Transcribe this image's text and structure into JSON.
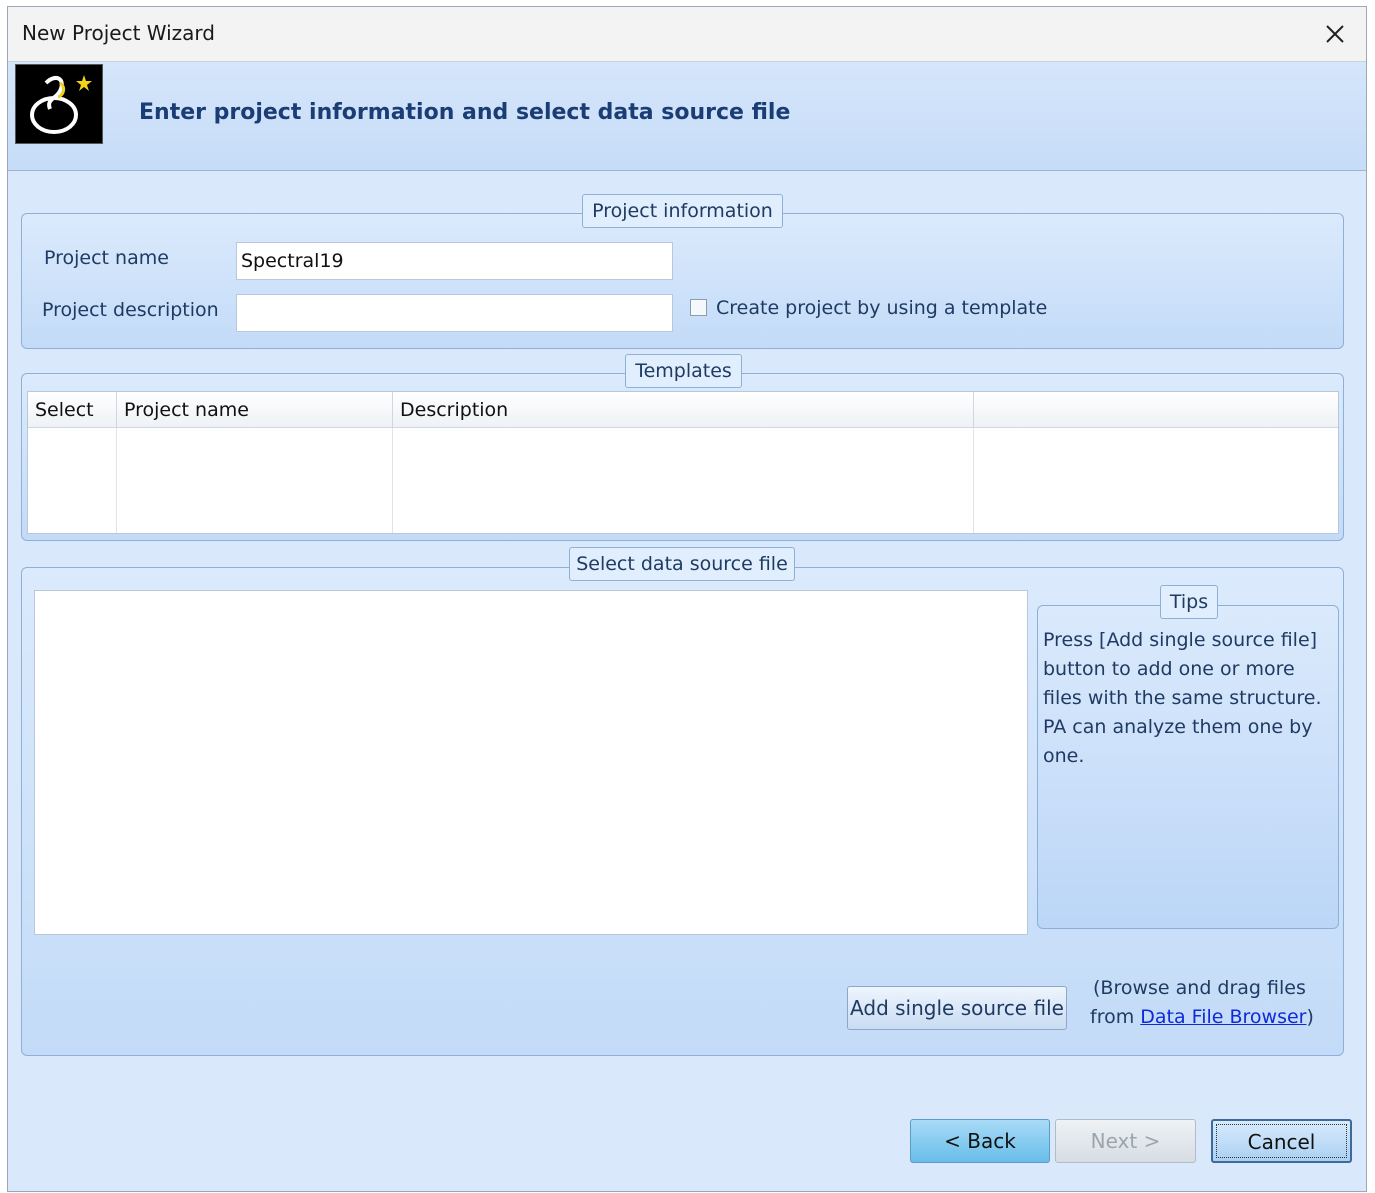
{
  "window": {
    "title": "New Project Wizard"
  },
  "header": {
    "title": "Enter project information and select data source file"
  },
  "project_info": {
    "legend": "Project information",
    "name_label": "Project name",
    "name_value": "Spectral19",
    "description_label": "Project description",
    "description_value": "",
    "template_checkbox_label": "Create project by using a template",
    "template_checked": false
  },
  "templates": {
    "legend": "Templates",
    "columns": [
      "Select",
      "Project name",
      "Description",
      ""
    ],
    "rows": []
  },
  "data_source": {
    "legend": "Select data source file",
    "tips_legend": "Tips",
    "tips_text": "Press [Add single source file] button to add one or more files with the same structure. PA can analyze them one by one.",
    "add_button": "Add single source file",
    "hint_prefix": "(Browse and drag files",
    "hint_from": "from ",
    "hint_link": "Data File Browser",
    "hint_suffix": ")"
  },
  "footer": {
    "back": "< Back",
    "next": "Next >",
    "cancel": "Cancel"
  }
}
